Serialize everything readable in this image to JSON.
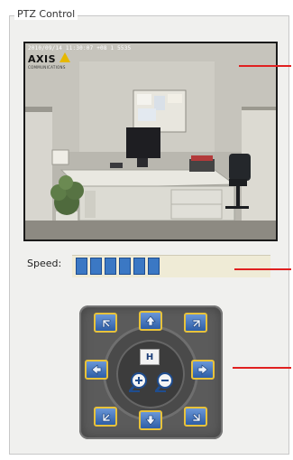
{
  "panel": {
    "title": "PTZ Control"
  },
  "camera": {
    "timestamp": "2010/09/14 11:30:07 +08 1 5535",
    "logo": "AXIS",
    "logo_sub": "COMMUNICATIONS"
  },
  "speed": {
    "label": "Speed:",
    "level_blocks": 6
  },
  "ptz": {
    "home_label": "H",
    "buttons": [
      {
        "name": "pan-up-left-button",
        "icon": "arrow-up-left-icon"
      },
      {
        "name": "tilt-up-button",
        "icon": "arrow-up-icon"
      },
      {
        "name": "pan-up-right-button",
        "icon": "arrow-up-right-icon"
      },
      {
        "name": "pan-left-button",
        "icon": "arrow-left-icon"
      },
      {
        "name": "pan-right-button",
        "icon": "arrow-right-icon"
      },
      {
        "name": "pan-down-left-button",
        "icon": "arrow-down-left-icon"
      },
      {
        "name": "tilt-down-button",
        "icon": "arrow-down-icon"
      },
      {
        "name": "pan-down-right-button",
        "icon": "arrow-down-right-icon"
      }
    ],
    "zoom_in_icon": "zoom-in-icon",
    "zoom_out_icon": "zoom-out-icon"
  },
  "colors": {
    "accent_blue": "#3b78c4",
    "button_border": "#e8c23a",
    "pointer_red": "#e02020"
  }
}
